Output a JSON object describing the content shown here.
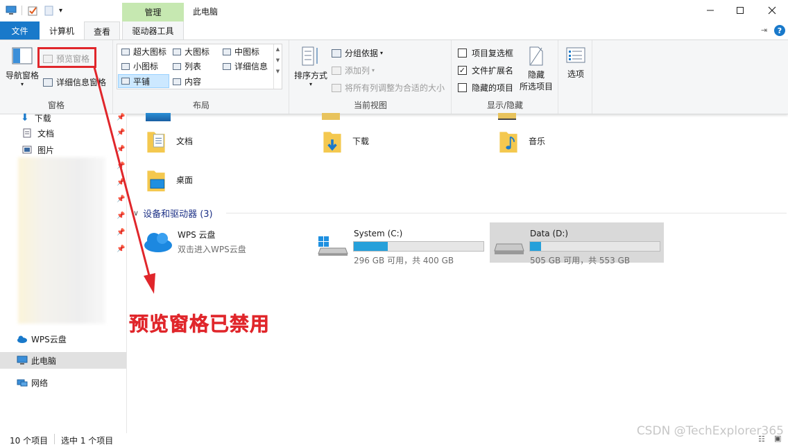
{
  "titlebar": {
    "title": "此电脑",
    "manage_tab": "管理",
    "controls": [
      "minimize-icon",
      "maximize-icon",
      "close-icon"
    ]
  },
  "tabs": {
    "file": "文件",
    "computer": "计算机",
    "view": "查看",
    "drive_tools": "驱动器工具"
  },
  "ribbon": {
    "panes": {
      "nav_pane": "导航窗格",
      "preview_pane": "预览窗格",
      "details_pane": "详细信息窗格",
      "label": "窗格"
    },
    "layout": {
      "extra_large": "超大图标",
      "large": "大图标",
      "medium": "中图标",
      "small": "小图标",
      "list": "列表",
      "details": "详细信息",
      "tiles": "平铺",
      "content": "内容",
      "label": "布局"
    },
    "current_view": {
      "sort": "排序方式",
      "group_by": "分组依据",
      "add_column": "添加列",
      "fit_columns": "将所有列调整为合适的大小",
      "label": "当前视图"
    },
    "show_hide": {
      "item_checkbox": "项目复选框",
      "file_ext": "文件扩展名",
      "hidden_items": "隐藏的项目",
      "hide_selected_1": "隐藏",
      "hide_selected_2": "所选项目",
      "label": "显示/隐藏",
      "file_ext_checked": true
    },
    "options": "选项"
  },
  "sidebar": {
    "downloads": "下载",
    "documents": "文档",
    "pictures": "图片",
    "wps": "WPS云盘",
    "this_pc": "此电脑",
    "network": "网络"
  },
  "main": {
    "folders": [
      {
        "label": "文档"
      },
      {
        "label": "下载"
      },
      {
        "label": "音乐"
      },
      {
        "label": "桌面"
      }
    ],
    "devices_header": "设备和驱动器 (3)",
    "wps_title": "WPS 云盘",
    "wps_subtitle": "双击进入WPS云盘",
    "drives": [
      {
        "name": "System (C:)",
        "info": "296 GB 可用，共 400 GB",
        "used_fraction": 0.26
      },
      {
        "name": "Data (D:)",
        "info": "505 GB 可用，共 553 GB",
        "used_fraction": 0.087
      }
    ]
  },
  "annotation": {
    "text": "预览窗格已禁用",
    "color": "#e0262b"
  },
  "status": {
    "count": "10 个项目",
    "selected": "选中 1 个项目"
  },
  "watermark": "CSDN @TechExplorer365"
}
